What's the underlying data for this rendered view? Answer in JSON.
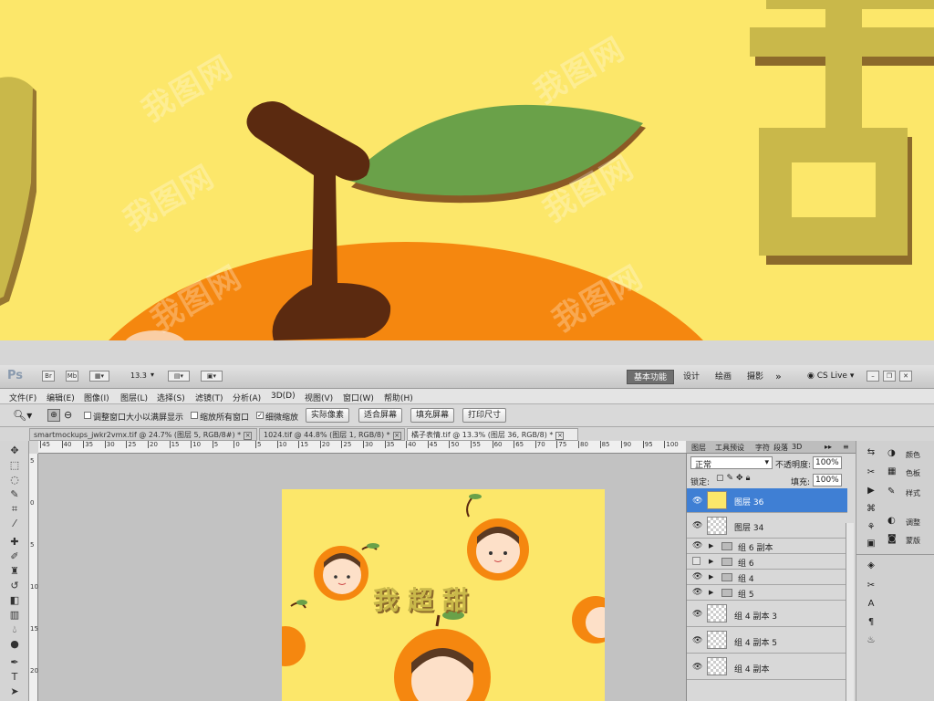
{
  "app": {
    "logo": "Ps",
    "bridge_btn": "Br",
    "minibridge_btn": "Mb",
    "zoom_value": "13.3",
    "workspaces": [
      {
        "label": "基本功能",
        "active": true
      },
      {
        "label": "设计",
        "active": false
      },
      {
        "label": "绘画",
        "active": false
      },
      {
        "label": "摄影",
        "active": false
      }
    ],
    "more": "»",
    "cs_live": "CS Live"
  },
  "menu": [
    "文件(F)",
    "编辑(E)",
    "图像(I)",
    "图层(L)",
    "选择(S)",
    "滤镜(T)",
    "分析(A)",
    "3D(D)",
    "视图(V)",
    "窗口(W)",
    "帮助(H)"
  ],
  "options": {
    "resize_window": "调整窗口大小以满屏显示",
    "zoom_all": "缩放所有窗口",
    "scrubby_zoom": "细微缩放",
    "actual_pixels": "实际像素",
    "fit_screen": "适合屏幕",
    "fill_screen": "填充屏幕",
    "print_size": "打印尺寸"
  },
  "documents": [
    {
      "title": "smartmockups_jwkr2vmx.tif @ 24.7% (图层 5, RGB/8#) *",
      "active": false
    },
    {
      "title": "1024.tif @ 44.8% (图层 1, RGB/8) *",
      "active": false
    },
    {
      "title": "橘子表情.tif @ 13.3% (图层 36, RGB/8) *",
      "active": true
    }
  ],
  "ruler": [
    "45",
    "40",
    "35",
    "30",
    "25",
    "20",
    "15",
    "10",
    "5",
    "0",
    "5",
    "10",
    "15",
    "20",
    "25",
    "30",
    "35",
    "40",
    "45",
    "50",
    "55",
    "60",
    "65",
    "70",
    "75",
    "80",
    "85",
    "90",
    "95",
    "100"
  ],
  "ruler_left": [
    "5",
    "0",
    "5",
    "10",
    "15",
    "20"
  ],
  "layers_panel": {
    "tabs": [
      "图层",
      "工具预设",
      "字符",
      "段落",
      "3D"
    ],
    "blend_mode": "正常",
    "opacity_label": "不透明度:",
    "opacity": "100%",
    "lock_label": "锁定:",
    "fill_label": "填充:",
    "fill": "100%",
    "layers": [
      {
        "name": "图层 36",
        "type": "layer",
        "selected": true,
        "visible": true
      },
      {
        "name": "图层 34",
        "type": "layer",
        "selected": false,
        "visible": true
      },
      {
        "name": "组 6 副本",
        "type": "group",
        "selected": false,
        "visible": true
      },
      {
        "name": "组 6",
        "type": "group",
        "selected": false,
        "visible": false
      },
      {
        "name": "组 4",
        "type": "group",
        "selected": false,
        "visible": true
      },
      {
        "name": "组 5",
        "type": "group",
        "selected": false,
        "visible": true
      },
      {
        "name": "组 4 副本 3",
        "type": "layer",
        "selected": false,
        "visible": true
      },
      {
        "name": "组 4 副本 5",
        "type": "layer",
        "selected": false,
        "visible": true
      },
      {
        "name": "组 4 副本",
        "type": "layer",
        "selected": false,
        "visible": true
      }
    ]
  },
  "dock": {
    "color": "颜色",
    "swatches": "色板",
    "styles": "样式",
    "adjustments": "调整",
    "masks": "蒙版"
  },
  "artwork": {
    "text": "我超甜"
  },
  "colors": {
    "art_bg": "#fce76a",
    "orange": "#f5870f",
    "leaf": "#6aa149",
    "stem": "#5b2a10",
    "char": "#c9b84a",
    "selection": "#3f7fd4"
  }
}
